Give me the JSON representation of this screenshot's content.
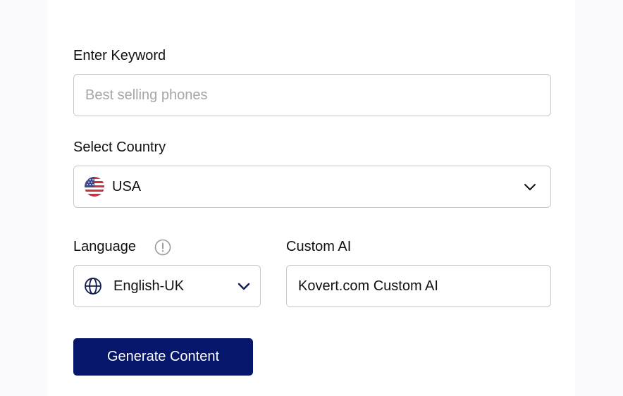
{
  "keyword": {
    "label": "Enter Keyword",
    "placeholder": "Best selling phones",
    "value": ""
  },
  "country": {
    "label": "Select Country",
    "selected": "USA",
    "flag_icon": "us-flag-icon"
  },
  "language": {
    "label": "Language",
    "selected": "English-UK",
    "info_icon": "info-icon",
    "globe_icon": "globe-icon"
  },
  "custom_ai": {
    "label": "Custom AI",
    "value": "Kovert.com Custom AI"
  },
  "generate_button": {
    "label": "Generate Content",
    "color": "#05166b"
  },
  "colors": {
    "border": "#c9c9c9",
    "placeholder": "#a6a6a6",
    "icon": "#0d1b4f",
    "page_bg": "#fbfbfd"
  }
}
